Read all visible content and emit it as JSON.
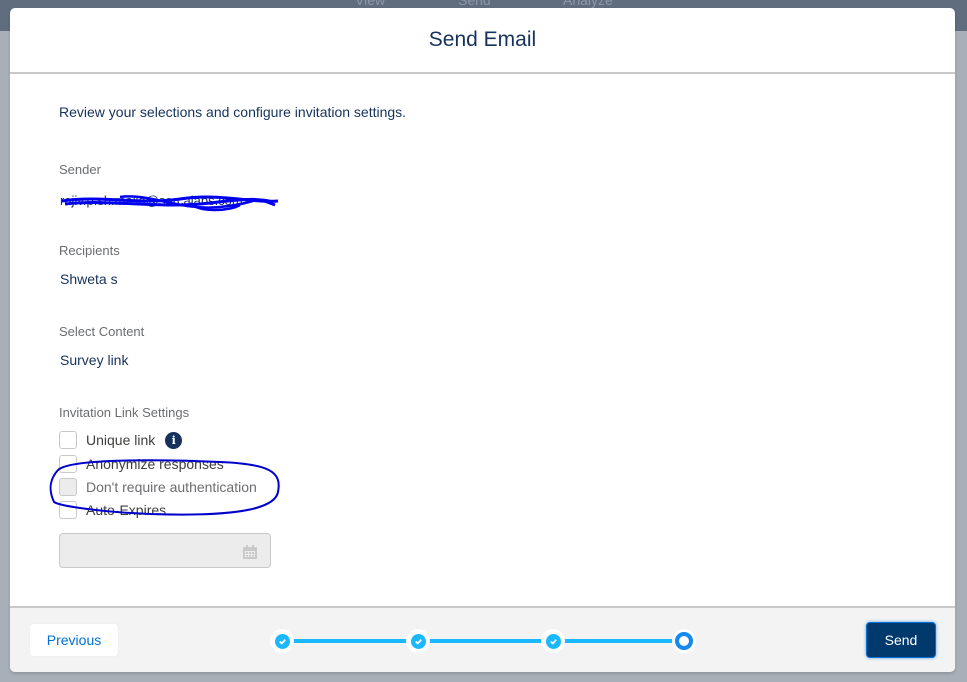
{
  "background_tabs": [
    "View",
    "Send",
    "Analyze"
  ],
  "modal": {
    "title": "Send Email",
    "intro": "Review your selections and configure invitation settings.",
    "fields": {
      "sender": {
        "label": "Sender",
        "value": "[redacted email]"
      },
      "recipients": {
        "label": "Recipients",
        "value": "Shweta s"
      },
      "content": {
        "label": "Select Content",
        "value": "Survey link"
      }
    },
    "link_settings": {
      "label": "Invitation Link Settings",
      "options": [
        {
          "label": "Unique link",
          "checked": false,
          "disabled": false,
          "info_icon": "info-icon"
        },
        {
          "label": "Anonymize responses",
          "checked": false,
          "disabled": false
        },
        {
          "label": "Don't require authentication",
          "checked": false,
          "disabled": true
        },
        {
          "label": "Auto-Expires",
          "checked": false,
          "disabled": false
        }
      ],
      "expiry_date": {
        "value": "",
        "placeholder": "",
        "icon": "calendar-icon"
      }
    }
  },
  "footer": {
    "previous_label": "Previous",
    "send_label": "Send",
    "stepper": {
      "total_steps": 4,
      "completed_steps": 3,
      "current_step": 4
    }
  },
  "colors": {
    "title": "#16325c",
    "accent": "#0070d2",
    "send_button": "#00396b",
    "stepper": "#1ab9ff",
    "annotation": "#0000cc"
  }
}
